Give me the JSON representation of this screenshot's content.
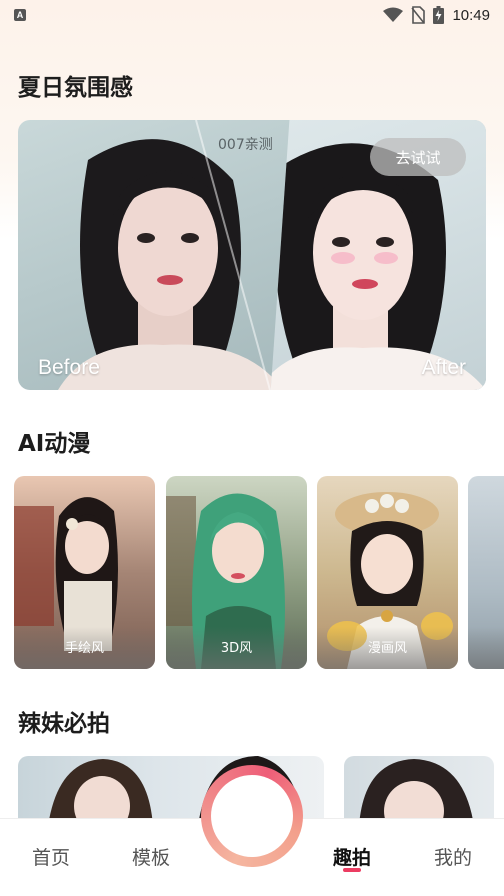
{
  "status_bar": {
    "notification_icon_label": "A",
    "time": "10:49",
    "icons": [
      "wifi-icon",
      "no-sim-icon",
      "battery-charging-icon"
    ]
  },
  "sections": {
    "summer": {
      "title": "夏日氛围感"
    },
    "anime": {
      "title": "AI动漫"
    },
    "hot_girl": {
      "title": "辣妹必拍"
    }
  },
  "hero": {
    "watermark": "007亲测",
    "try_button": "去试试",
    "before_label": "Before",
    "after_label": "After"
  },
  "anime_cards": [
    {
      "caption": "手绘风"
    },
    {
      "caption": "3D风"
    },
    {
      "caption": "漫画风"
    }
  ],
  "bottom_nav": {
    "items": [
      {
        "label": "首页"
      },
      {
        "label": "模板"
      },
      {
        "label": "趣拍"
      },
      {
        "label": "我的"
      }
    ],
    "active": "趣拍",
    "accent_color": "#ec3d62"
  }
}
